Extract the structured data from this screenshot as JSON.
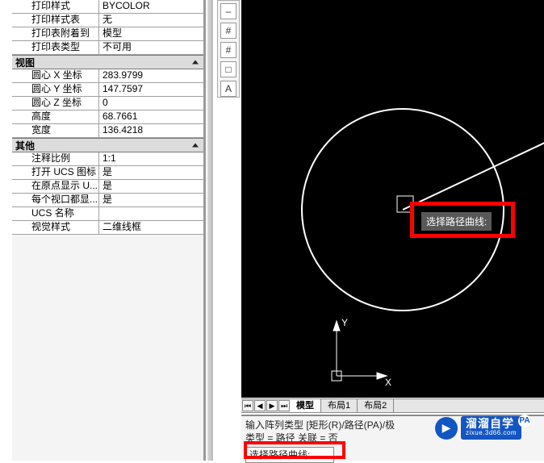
{
  "sections": {
    "print": {
      "rows": [
        {
          "k": "打印样式",
          "v": "BYCOLOR"
        },
        {
          "k": "打印样式表",
          "v": "无"
        },
        {
          "k": "打印表附着到",
          "v": "模型"
        },
        {
          "k": "打印表类型",
          "v": "不可用"
        }
      ]
    },
    "view": {
      "title": "视图",
      "rows": [
        {
          "k": "圆心 X 坐标",
          "v": "283.9799"
        },
        {
          "k": "圆心 Y 坐标",
          "v": "147.7597"
        },
        {
          "k": "圆心 Z 坐标",
          "v": "0"
        },
        {
          "k": "高度",
          "v": "68.7661"
        },
        {
          "k": "宽度",
          "v": "136.4218"
        }
      ]
    },
    "other": {
      "title": "其他",
      "rows": [
        {
          "k": "注释比例",
          "v": "1:1"
        },
        {
          "k": "打开 UCS 图标",
          "v": "是"
        },
        {
          "k": "在原点显示 U...",
          "v": "是"
        },
        {
          "k": "每个视口都显...",
          "v": "是"
        },
        {
          "k": "UCS 名称",
          "v": ""
        },
        {
          "k": "视觉样式",
          "v": "二维线框"
        }
      ]
    }
  },
  "toolbar_icons": [
    "–",
    "#",
    "#",
    "□",
    "A"
  ],
  "tooltip": "选择路径曲线:",
  "ucs": {
    "x": "X",
    "y": "Y"
  },
  "tabs": {
    "items": [
      "模型",
      "布局1",
      "布局2"
    ],
    "active": 0
  },
  "cmd": {
    "line1": "输入阵列类型 [矩形(R)/路径(PA)/极",
    "line1_right": "PA",
    "line2": "类型 = 路径  关联 = 否",
    "prompt": "选择路径曲线:"
  },
  "logo": {
    "brand": "溜溜自学",
    "url": "zixue.3d66.com",
    "badge": "PA"
  }
}
